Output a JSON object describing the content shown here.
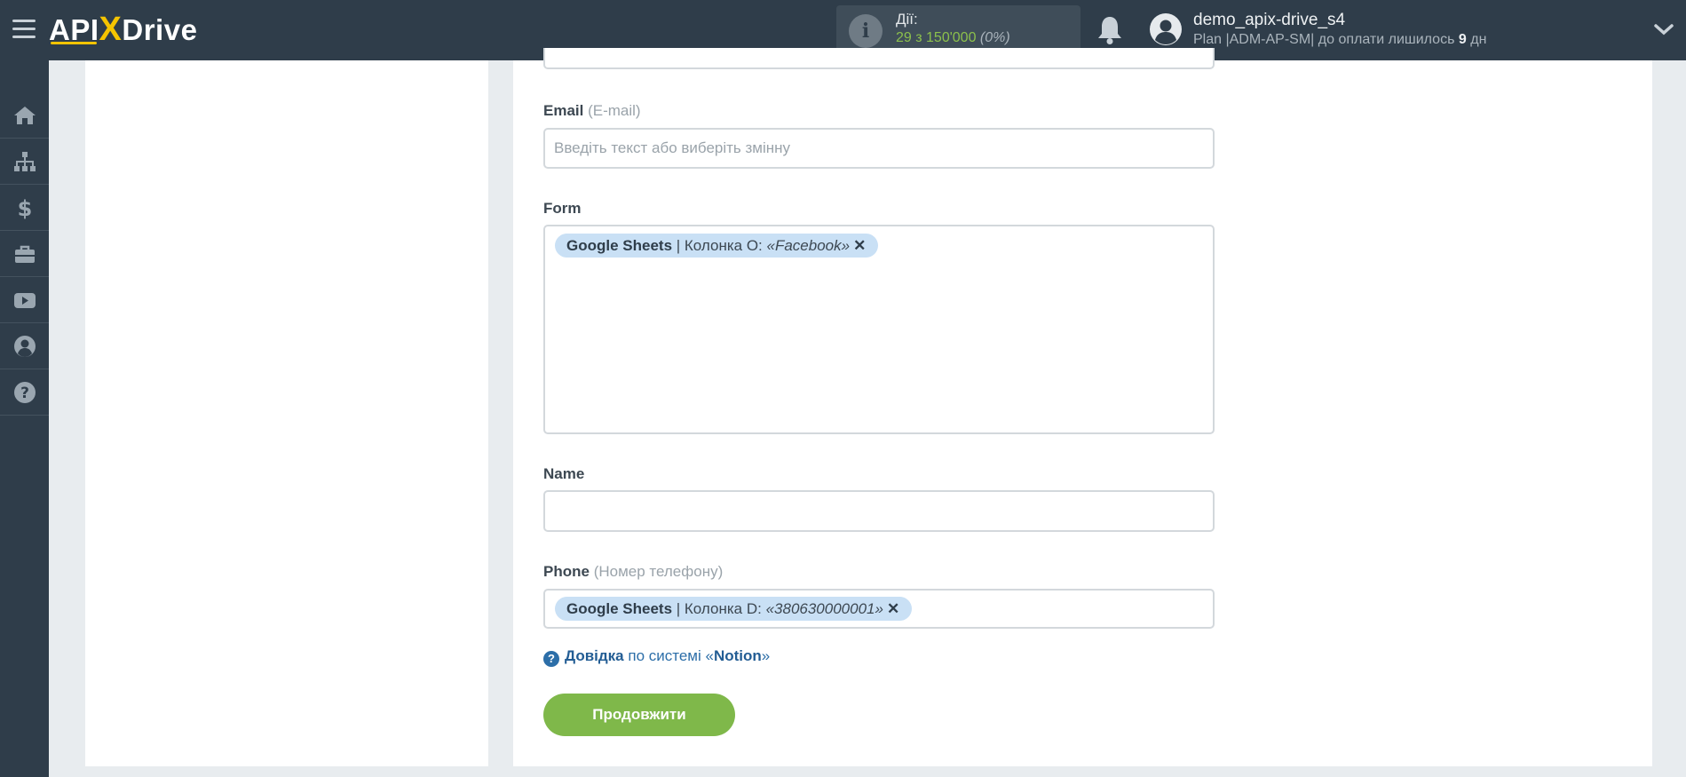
{
  "header": {
    "logo_api": "API",
    "logo_x": "X",
    "logo_drive": "Drive",
    "actions_label": "Дії:",
    "actions_count": "29 з 150'000",
    "actions_percent": "(0%)",
    "username": "demo_apix-drive_s4",
    "plan_prefix": "Plan |ADM-AP-SM| до оплати лишилось",
    "plan_days": "9",
    "plan_suffix": "дн"
  },
  "sidebar": {
    "items": [
      {
        "icon": "home-icon"
      },
      {
        "icon": "sitemap-icon"
      },
      {
        "icon": "dollar-icon"
      },
      {
        "icon": "briefcase-icon"
      },
      {
        "icon": "youtube-icon"
      },
      {
        "icon": "user-circle-icon"
      },
      {
        "icon": "question-circle-icon"
      }
    ]
  },
  "form": {
    "email": {
      "label": "Email",
      "hint": "(E-mail)",
      "placeholder": "Введіть текст або виберіть змінну"
    },
    "form_field": {
      "label": "Form",
      "tag": {
        "source": "Google Sheets",
        "column": "| Колонка O:",
        "value": "«Facebook»"
      }
    },
    "name": {
      "label": "Name"
    },
    "phone": {
      "label": "Phone",
      "hint": "(Номер телефону)",
      "tag": {
        "source": "Google Sheets",
        "column": "| Колонка D:",
        "value": "«380630000001»"
      }
    },
    "help": {
      "link": "Довідка",
      "text": "по системі «",
      "system": "Notion",
      "end": "»"
    },
    "continue_label": "Продовжити"
  },
  "colors": {
    "topbar": "#2f3d4a",
    "accent_yellow": "#f5c400",
    "button_green": "#7fb84a",
    "tag_blue": "#c9e0f5",
    "link_blue": "#2c6ea8"
  }
}
